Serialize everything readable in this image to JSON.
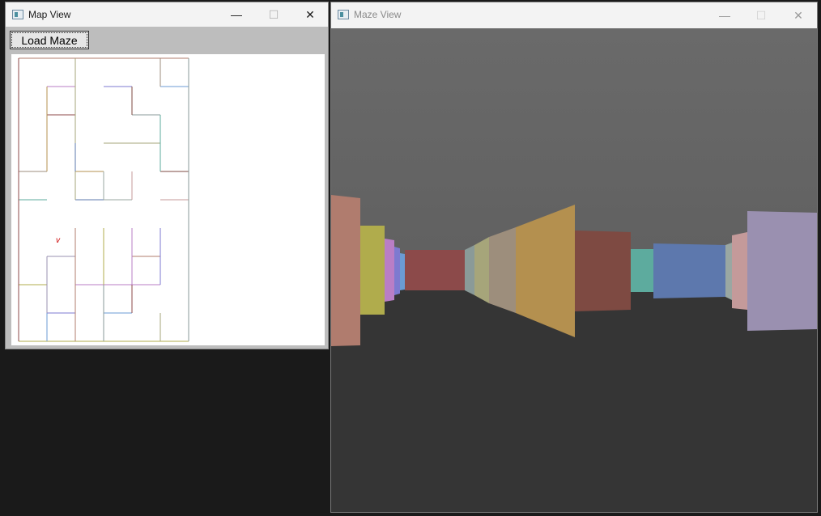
{
  "map_window": {
    "title": "Map View",
    "load_button_label": "Load Maze",
    "controls": {
      "minimize": "—",
      "maximize": "☐",
      "close": "✕"
    },
    "player_marker": "v",
    "colors": {
      "background": "#bdbdbd",
      "canvas": "#ffffff",
      "marker": "#cc0000"
    }
  },
  "maze_window": {
    "title": "Maze View",
    "controls": {
      "minimize": "—",
      "maximize": "☐",
      "close": "✕"
    },
    "colors": {
      "ceiling": "#6a6a6a",
      "floor": "#353535"
    },
    "wall_colors": [
      "#b07c6e",
      "#b0ac4c",
      "#b97ec6",
      "#7d7ad0",
      "#6b9bd4",
      "#8c4a4a",
      "#8a9a98",
      "#a6a57a",
      "#9d8e7c",
      "#b4904f",
      "#7e4a42",
      "#5dab9e",
      "#5d78ad",
      "#9aa7a2",
      "#c49a9a",
      "#9a90b0"
    ]
  }
}
